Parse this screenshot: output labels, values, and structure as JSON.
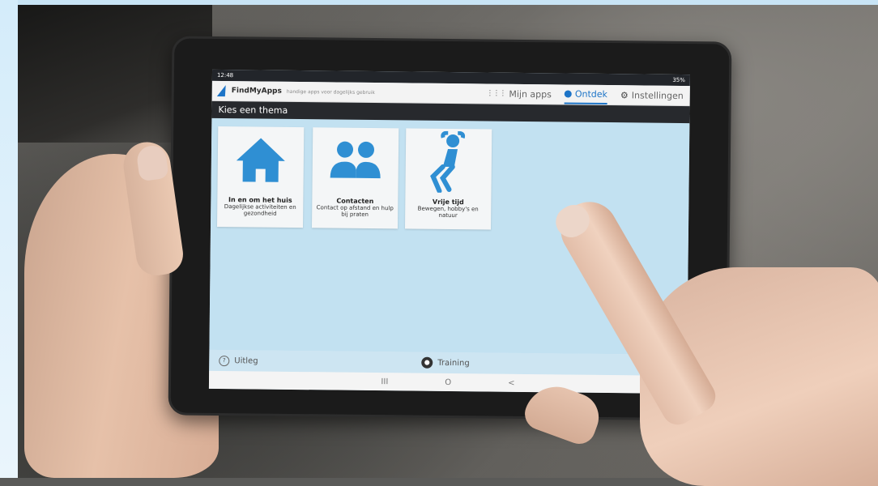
{
  "status": {
    "time": "12:48",
    "battery": "35%"
  },
  "app": {
    "name": "FindMyApps",
    "tagline": "handige apps voor dagelijks gebruik"
  },
  "nav": [
    {
      "label": "Mijn apps",
      "icon": "grid-icon"
    },
    {
      "label": "Ontdek",
      "icon": "compass-icon",
      "active": true
    },
    {
      "label": "Instellingen",
      "icon": "gear-icon"
    }
  ],
  "page_title": "Kies een thema",
  "themes": [
    {
      "title": "In en om het huis",
      "subtitle": "Dagelijkse activiteiten en gezondheid",
      "icon": "house-icon"
    },
    {
      "title": "Contacten",
      "subtitle": "Contact op afstand en hulp bij praten",
      "icon": "people-icon"
    },
    {
      "title": "Vrije tijd",
      "subtitle": "Bewegen, hobby's en natuur",
      "icon": "person-relaxing-icon"
    }
  ],
  "footer": {
    "help_label": "Uitleg",
    "training_label": "Training"
  },
  "android_nav": {
    "recents": "III",
    "home": "O",
    "back": "<"
  },
  "colors": {
    "accent": "#1d74c7",
    "icon_blue": "#2f8fd3",
    "content_bg": "#c2e1f1"
  }
}
